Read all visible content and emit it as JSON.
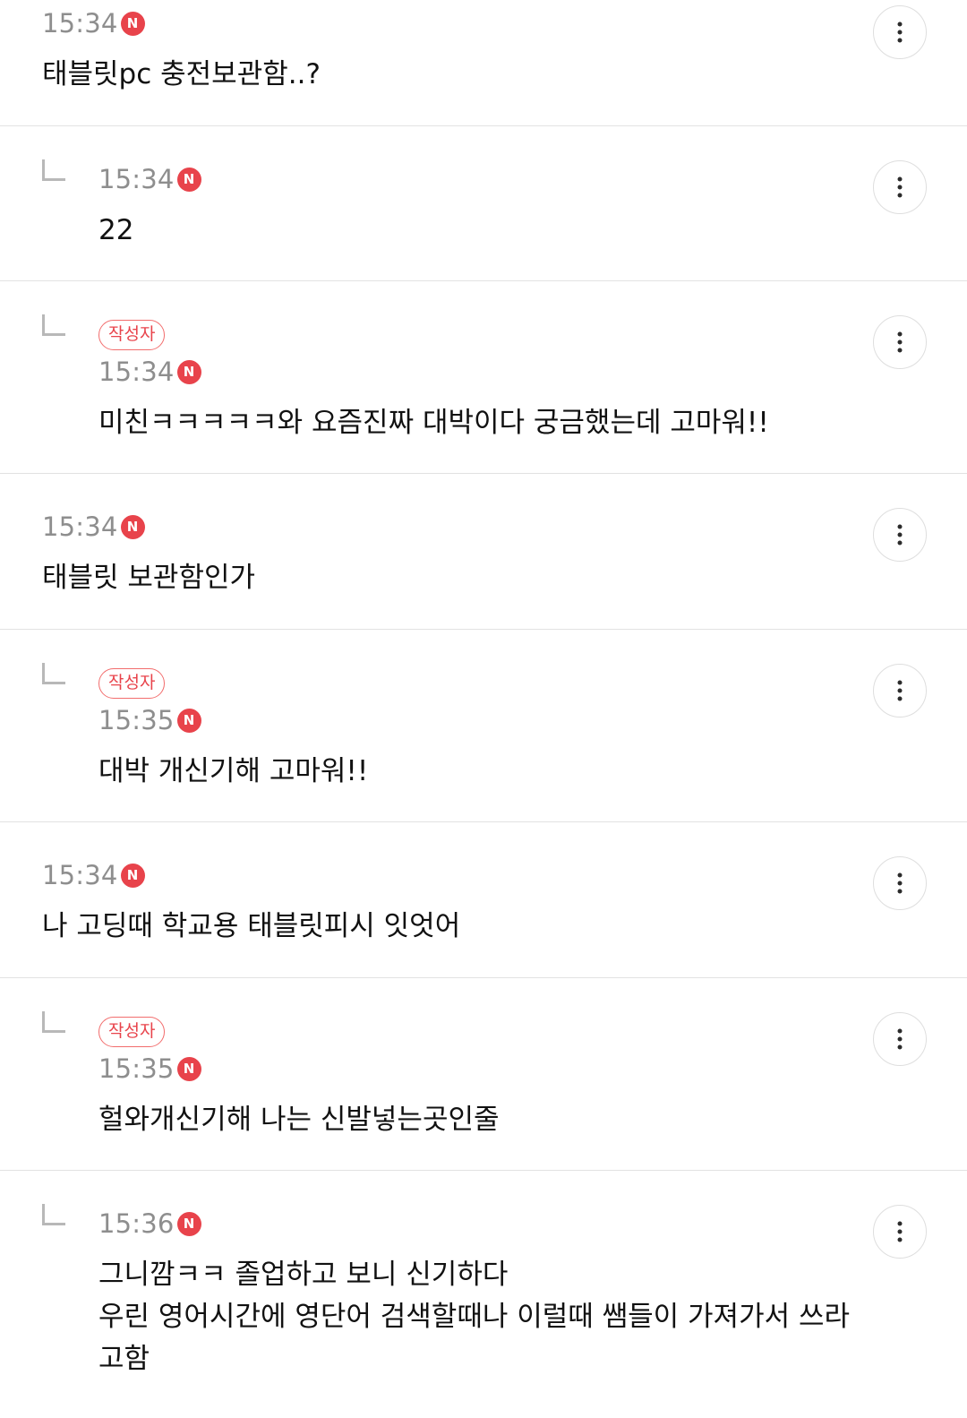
{
  "comments": [
    {
      "is_reply": false,
      "is_author": false,
      "time": "15:34",
      "new_badge": "N",
      "lines": [
        "태블릿pc 충전보관함..?"
      ]
    },
    {
      "is_reply": true,
      "is_author": false,
      "time": "15:34",
      "new_badge": "N",
      "lines": [
        "22"
      ]
    },
    {
      "is_reply": true,
      "is_author": true,
      "author_label": "작성자",
      "time": "15:34",
      "new_badge": "N",
      "lines": [
        "미친ㅋㅋㅋㅋㅋ와 요즘진짜 대박이다 궁금했는데 고마워!!"
      ]
    },
    {
      "is_reply": false,
      "is_author": false,
      "time": "15:34",
      "new_badge": "N",
      "lines": [
        "태블릿 보관함인가"
      ]
    },
    {
      "is_reply": true,
      "is_author": true,
      "author_label": "작성자",
      "time": "15:35",
      "new_badge": "N",
      "lines": [
        "대박 개신기해 고마워!!"
      ]
    },
    {
      "is_reply": false,
      "is_author": false,
      "time": "15:34",
      "new_badge": "N",
      "lines": [
        "나 고딩때 학교용 태블릿피시 잇엇어"
      ]
    },
    {
      "is_reply": true,
      "is_author": true,
      "author_label": "작성자",
      "time": "15:35",
      "new_badge": "N",
      "lines": [
        "헐와개신기해 나는 신발넣는곳인줄"
      ]
    },
    {
      "is_reply": true,
      "is_author": false,
      "time": "15:36",
      "new_badge": "N",
      "lines": [
        "그니깜ㅋㅋ 졸업하고 보니 신기하다",
        "우린 영어시간에 영단어 검색할때나 이럴때 쌤들이 가져가서 쓰라",
        "고함"
      ]
    }
  ],
  "icons": {
    "reply": "reply-arrow-icon",
    "more": "more-vertical-icon",
    "new": "new-badge-icon"
  },
  "colors": {
    "accent": "#e8434b",
    "time_text": "#8e8e8e",
    "divider": "#e2e2e2",
    "body_text": "#111111"
  }
}
